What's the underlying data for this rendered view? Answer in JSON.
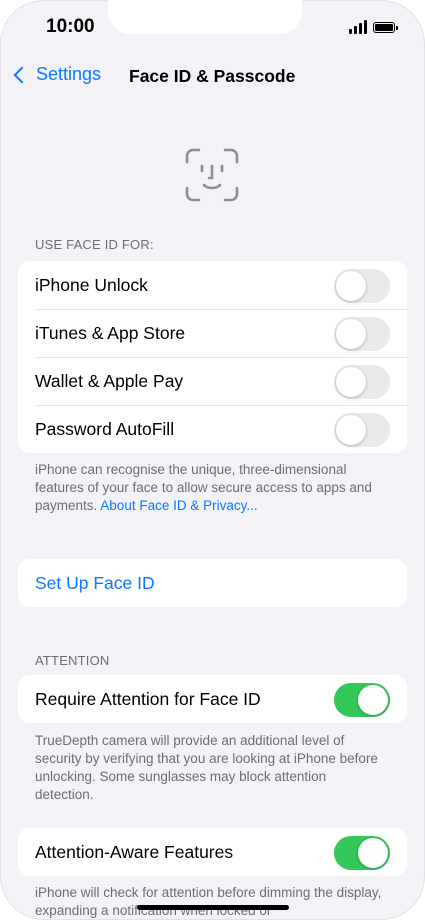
{
  "status_bar": {
    "time": "10:00"
  },
  "nav": {
    "back_label": "Settings",
    "title": "Face ID & Passcode"
  },
  "use_face_id": {
    "header": "USE FACE ID FOR:",
    "items": [
      {
        "label": "iPhone Unlock",
        "on": false
      },
      {
        "label": "iTunes & App Store",
        "on": false
      },
      {
        "label": "Wallet & Apple Pay",
        "on": false
      },
      {
        "label": "Password AutoFill",
        "on": false
      }
    ],
    "footer_text": "iPhone can recognise the unique, three-dimensional features of your face to allow secure access to apps and payments. ",
    "footer_link": "About Face ID & Privacy..."
  },
  "setup": {
    "label": "Set Up Face ID"
  },
  "attention": {
    "header": "ATTENTION",
    "require_label": "Require Attention for Face ID",
    "require_on": true,
    "require_footer": "TrueDepth camera will provide an additional level of security by verifying that you are looking at iPhone before unlocking. Some sunglasses may block attention detection.",
    "aware_label": "Attention-Aware Features",
    "aware_on": true,
    "aware_footer": "iPhone will check for attention before dimming the display, expanding a notification when locked or"
  },
  "colors": {
    "accent": "#0a7aff",
    "toggle_on": "#34c759",
    "toggle_off": "#e9e9eb",
    "background": "#f2f2f7"
  }
}
